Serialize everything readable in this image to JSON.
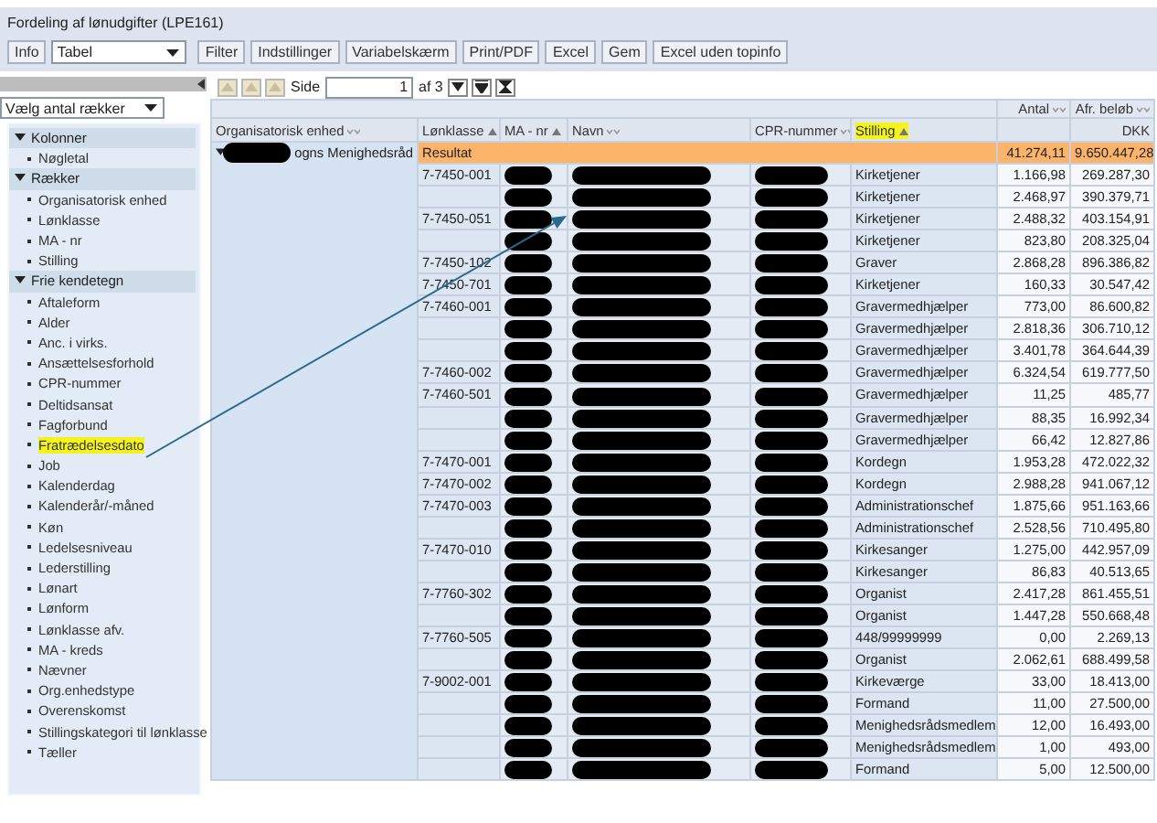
{
  "title": "Fordeling af lønudgifter (LPE161)",
  "toolbar": {
    "info_button": "Info",
    "view_select": "Tabel",
    "buttons": [
      "Filter",
      "Indstillinger",
      "Variabelskærm",
      "Print/PDF",
      "Excel",
      "Gem",
      "Excel uden topinfo"
    ]
  },
  "sidebar": {
    "rows_select": "Vælg antal rækker",
    "groups": [
      {
        "label": "Kolonner",
        "expanded": true,
        "children": [
          {
            "label": "Nøgletal",
            "highlighted": false
          }
        ]
      },
      {
        "label": "Rækker",
        "expanded": true,
        "children": [
          {
            "label": "Organisatorisk enhed",
            "highlighted": false
          },
          {
            "label": "Lønklasse",
            "highlighted": false
          },
          {
            "label": "MA - nr",
            "highlighted": false
          },
          {
            "label": "Stilling",
            "highlighted": false
          }
        ]
      },
      {
        "label": "Frie kendetegn",
        "expanded": true,
        "children": [
          {
            "label": "Aftaleform",
            "highlighted": false
          },
          {
            "label": "Alder",
            "highlighted": false
          },
          {
            "label": "Anc. i virks.",
            "highlighted": false
          },
          {
            "label": "Ansættelsesforhold",
            "highlighted": false
          },
          {
            "label": "CPR-nummer",
            "highlighted": false
          },
          {
            "label": "Deltidsansat",
            "highlighted": false
          },
          {
            "label": "Fagforbund",
            "highlighted": false
          },
          {
            "label": "Fratrædelsesdato",
            "highlighted": true
          },
          {
            "label": "Job",
            "highlighted": false
          },
          {
            "label": "Kalenderdag",
            "highlighted": false
          },
          {
            "label": "Kalenderår/-måned",
            "highlighted": false
          },
          {
            "label": "Køn",
            "highlighted": false
          },
          {
            "label": "Ledelsesniveau",
            "highlighted": false
          },
          {
            "label": "Lederstilling",
            "highlighted": false
          },
          {
            "label": "Lønart",
            "highlighted": false
          },
          {
            "label": "Lønform",
            "highlighted": false
          },
          {
            "label": "Lønklasse afv.",
            "highlighted": false
          },
          {
            "label": "MA - kreds",
            "highlighted": false
          },
          {
            "label": "Nævner",
            "highlighted": false
          },
          {
            "label": "Org.enhedstype",
            "highlighted": false
          },
          {
            "label": "Overenskomst",
            "highlighted": false
          },
          {
            "label": "Stillingskategori til lønklasse",
            "highlighted": false
          },
          {
            "label": "Tæller",
            "highlighted": false
          }
        ]
      }
    ]
  },
  "pager": {
    "nav_disabled": true,
    "label": "Side",
    "page": "1",
    "of": "af 3"
  },
  "table": {
    "columns": [
      {
        "label": "Organisatorisk enhed",
        "sort_ascending": false,
        "redacted": false,
        "highlighted": false
      },
      {
        "label": "Lønklasse",
        "sort_ascending": true,
        "redacted": false,
        "highlighted": false
      },
      {
        "label": "MA - nr",
        "sort_ascending": true,
        "redacted": true,
        "highlighted": false
      },
      {
        "label": "Navn",
        "sort_ascending": false,
        "redacted": true,
        "highlighted": false
      },
      {
        "label": "CPR-nummer",
        "sort_ascending": false,
        "redacted": true,
        "highlighted": false
      },
      {
        "label": "Stilling",
        "sort_ascending": true,
        "redacted": false,
        "highlighted": true
      }
    ],
    "measures": [
      {
        "label": "Antal"
      },
      {
        "label": "Afr. beløb",
        "unit": "DKK"
      }
    ],
    "org_unit": {
      "text": "ogns Menighedsråd",
      "expanded": true,
      "start_redacted": true
    },
    "result": {
      "label": "Resultat",
      "antal": "41.274,11",
      "belob": "9.650.447,28"
    },
    "rows": [
      {
        "lonklasse": "7-7450-001",
        "stilling": "Kirketjener",
        "antal": "1.166,98",
        "belob": "269.287,30"
      },
      {
        "stilling": "Kirketjener",
        "antal": "2.468,97",
        "belob": "390.379,71"
      },
      {
        "lonklasse": "7-7450-051",
        "stilling": "Kirketjener",
        "antal": "2.488,32",
        "belob": "403.154,91"
      },
      {
        "stilling": "Kirketjener",
        "antal": "823,80",
        "belob": "208.325,04"
      },
      {
        "lonklasse": "7-7450-102",
        "stilling": "Graver",
        "antal": "2.868,28",
        "belob": "896.386,82"
      },
      {
        "lonklasse": "7-7450-701",
        "stilling": "Kirketjener",
        "antal": "160,33",
        "belob": "30.547,42"
      },
      {
        "lonklasse": "7-7460-001",
        "stilling": "Gravermedhjælper",
        "antal": "773,00",
        "belob": "86.600,82"
      },
      {
        "stilling": "Gravermedhjælper",
        "antal": "2.818,36",
        "belob": "306.710,12"
      },
      {
        "stilling": "Gravermedhjælper",
        "antal": "3.401,78",
        "belob": "364.644,39"
      },
      {
        "lonklasse": "7-7460-002",
        "stilling": "Gravermedhjælper",
        "antal": "6.324,54",
        "belob": "619.777,50"
      },
      {
        "lonklasse": "7-7460-501",
        "stilling": "Gravermedhjælper",
        "antal": "11,25",
        "belob": "485,77"
      },
      {
        "stilling": "Gravermedhjælper",
        "antal": "88,35",
        "belob": "16.992,34"
      },
      {
        "stilling": "Gravermedhjælper",
        "antal": "66,42",
        "belob": "12.827,86"
      },
      {
        "lonklasse": "7-7470-001",
        "stilling": "Kordegn",
        "antal": "1.953,28",
        "belob": "472.022,32"
      },
      {
        "lonklasse": "7-7470-002",
        "stilling": "Kordegn",
        "antal": "2.988,28",
        "belob": "941.067,12"
      },
      {
        "lonklasse": "7-7470-003",
        "stilling": "Administrationschef",
        "antal": "1.875,66",
        "belob": "951.163,66"
      },
      {
        "stilling": "Administrationschef",
        "antal": "2.528,56",
        "belob": "710.495,80"
      },
      {
        "lonklasse": "7-7470-010",
        "stilling": "Kirkesanger",
        "antal": "1.275,00",
        "belob": "442.957,09"
      },
      {
        "stilling": "Kirkesanger",
        "antal": "86,83",
        "belob": "40.513,65"
      },
      {
        "lonklasse": "7-7760-302",
        "stilling": "Organist",
        "antal": "2.417,28",
        "belob": "861.455,51"
      },
      {
        "stilling": "Organist",
        "antal": "1.447,28",
        "belob": "550.668,48"
      },
      {
        "lonklasse": "7-7760-505",
        "stilling": "448/99999999",
        "antal": "0,00",
        "belob": "2.269,13"
      },
      {
        "stilling": "Organist",
        "antal": "2.062,61",
        "belob": "688.499,58"
      },
      {
        "lonklasse": "7-9002-001",
        "stilling": "Kirkeværge",
        "antal": "33,00",
        "belob": "18.413,00"
      },
      {
        "stilling": "Formand",
        "antal": "11,00",
        "belob": "27.500,00"
      },
      {
        "stilling": "Menighedsrådsmedlem",
        "antal": "12,00",
        "belob": "16.493,00"
      },
      {
        "stilling": "Menighedsrådsmedlem",
        "antal": "1,00",
        "belob": "493,00"
      },
      {
        "stilling": "Formand",
        "antal": "5,00",
        "belob": "12.500,00"
      }
    ]
  }
}
